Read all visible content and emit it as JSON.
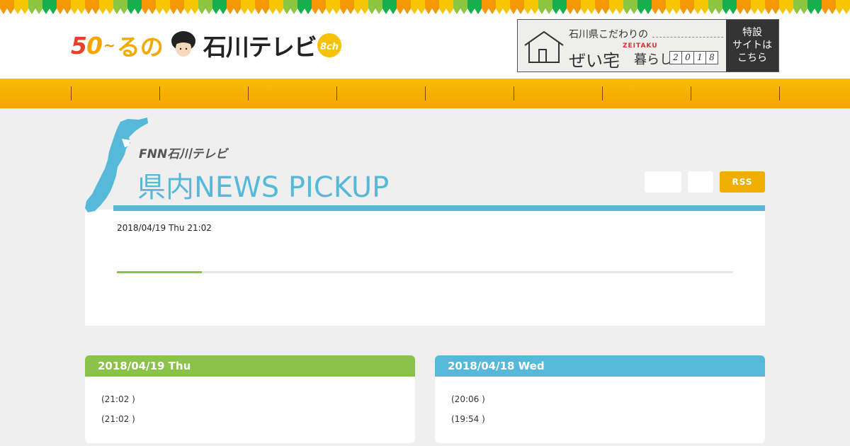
{
  "colors": {
    "accent_orange": "#f6a402",
    "accent_blue": "#57b9da",
    "accent_green": "#8bc34a",
    "rss_bg": "#f0ae00",
    "pennant": [
      "#f39800",
      "#f6c500",
      "#8cc63f",
      "#16b04b",
      "#f39800",
      "#f6c500"
    ]
  },
  "header": {
    "logo": {
      "anniv_5": "5",
      "anniv_0": "0",
      "anniv_tilde": "~",
      "anniv_ru": "るの",
      "station_name": "石川テレビ",
      "channel": "8ch",
      "icon": "face-icon"
    },
    "banner": {
      "subtitle": "石川県こだわりの",
      "title_main": "ぜい宅",
      "title_rest": "暮らし",
      "romaji": "ZEITAKU",
      "year_digits": [
        "2",
        "0",
        "1",
        "8"
      ],
      "cta": [
        "特設",
        "サイトは",
        "こちら"
      ],
      "icon": "house-icon"
    }
  },
  "nav": {
    "separator_count": 9
  },
  "news": {
    "fnn_label": "FNN石川テレビ",
    "title": "県内NEWS  PICKUP",
    "rss_label": "RSS",
    "datetime": "2018/04/19 Thu 21:02",
    "progress_fraction": 0.138,
    "map_icon": "ishikawa-map-icon"
  },
  "days": [
    {
      "date": "2018/04/19 Thu",
      "color": "#8bc34a",
      "items": [
        "(21:02 )",
        "(21:02 )"
      ]
    },
    {
      "date": "2018/04/18 Wed",
      "color": "#57b9da",
      "items": [
        "(20:06 )",
        "(19:54 )"
      ]
    }
  ]
}
